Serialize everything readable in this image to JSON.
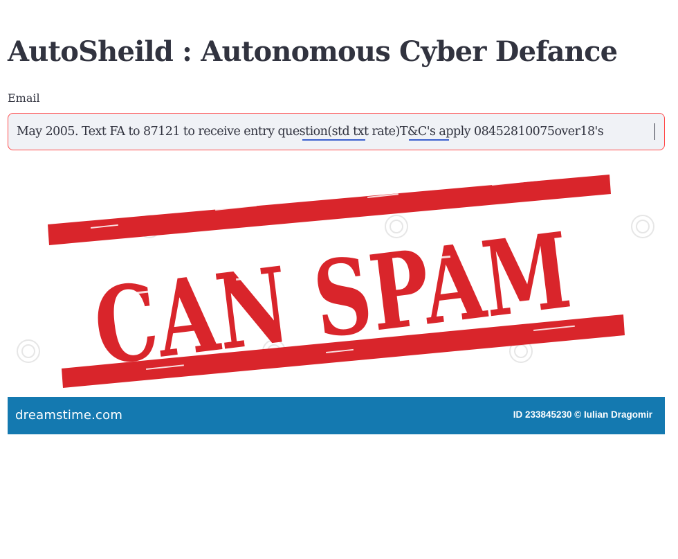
{
  "page": {
    "title": "AutoSheild : Autonomous Cyber Defance"
  },
  "email": {
    "label": "Email",
    "value": "May 2005. Text FA to 87121 to receive entry question(std txt rate)T&C's apply 08452810075over18's",
    "border_color": "#ff4b4b",
    "background_color": "#f0f2f6"
  },
  "image": {
    "stamp_text": "CAN SPAM",
    "stamp_color": "#d9252b",
    "watermark": "dreamstime",
    "footer": {
      "brand": "dreamstime.com",
      "credit": "ID 233845230 © Iulian Dragomir",
      "background_color": "#1479b0"
    }
  }
}
